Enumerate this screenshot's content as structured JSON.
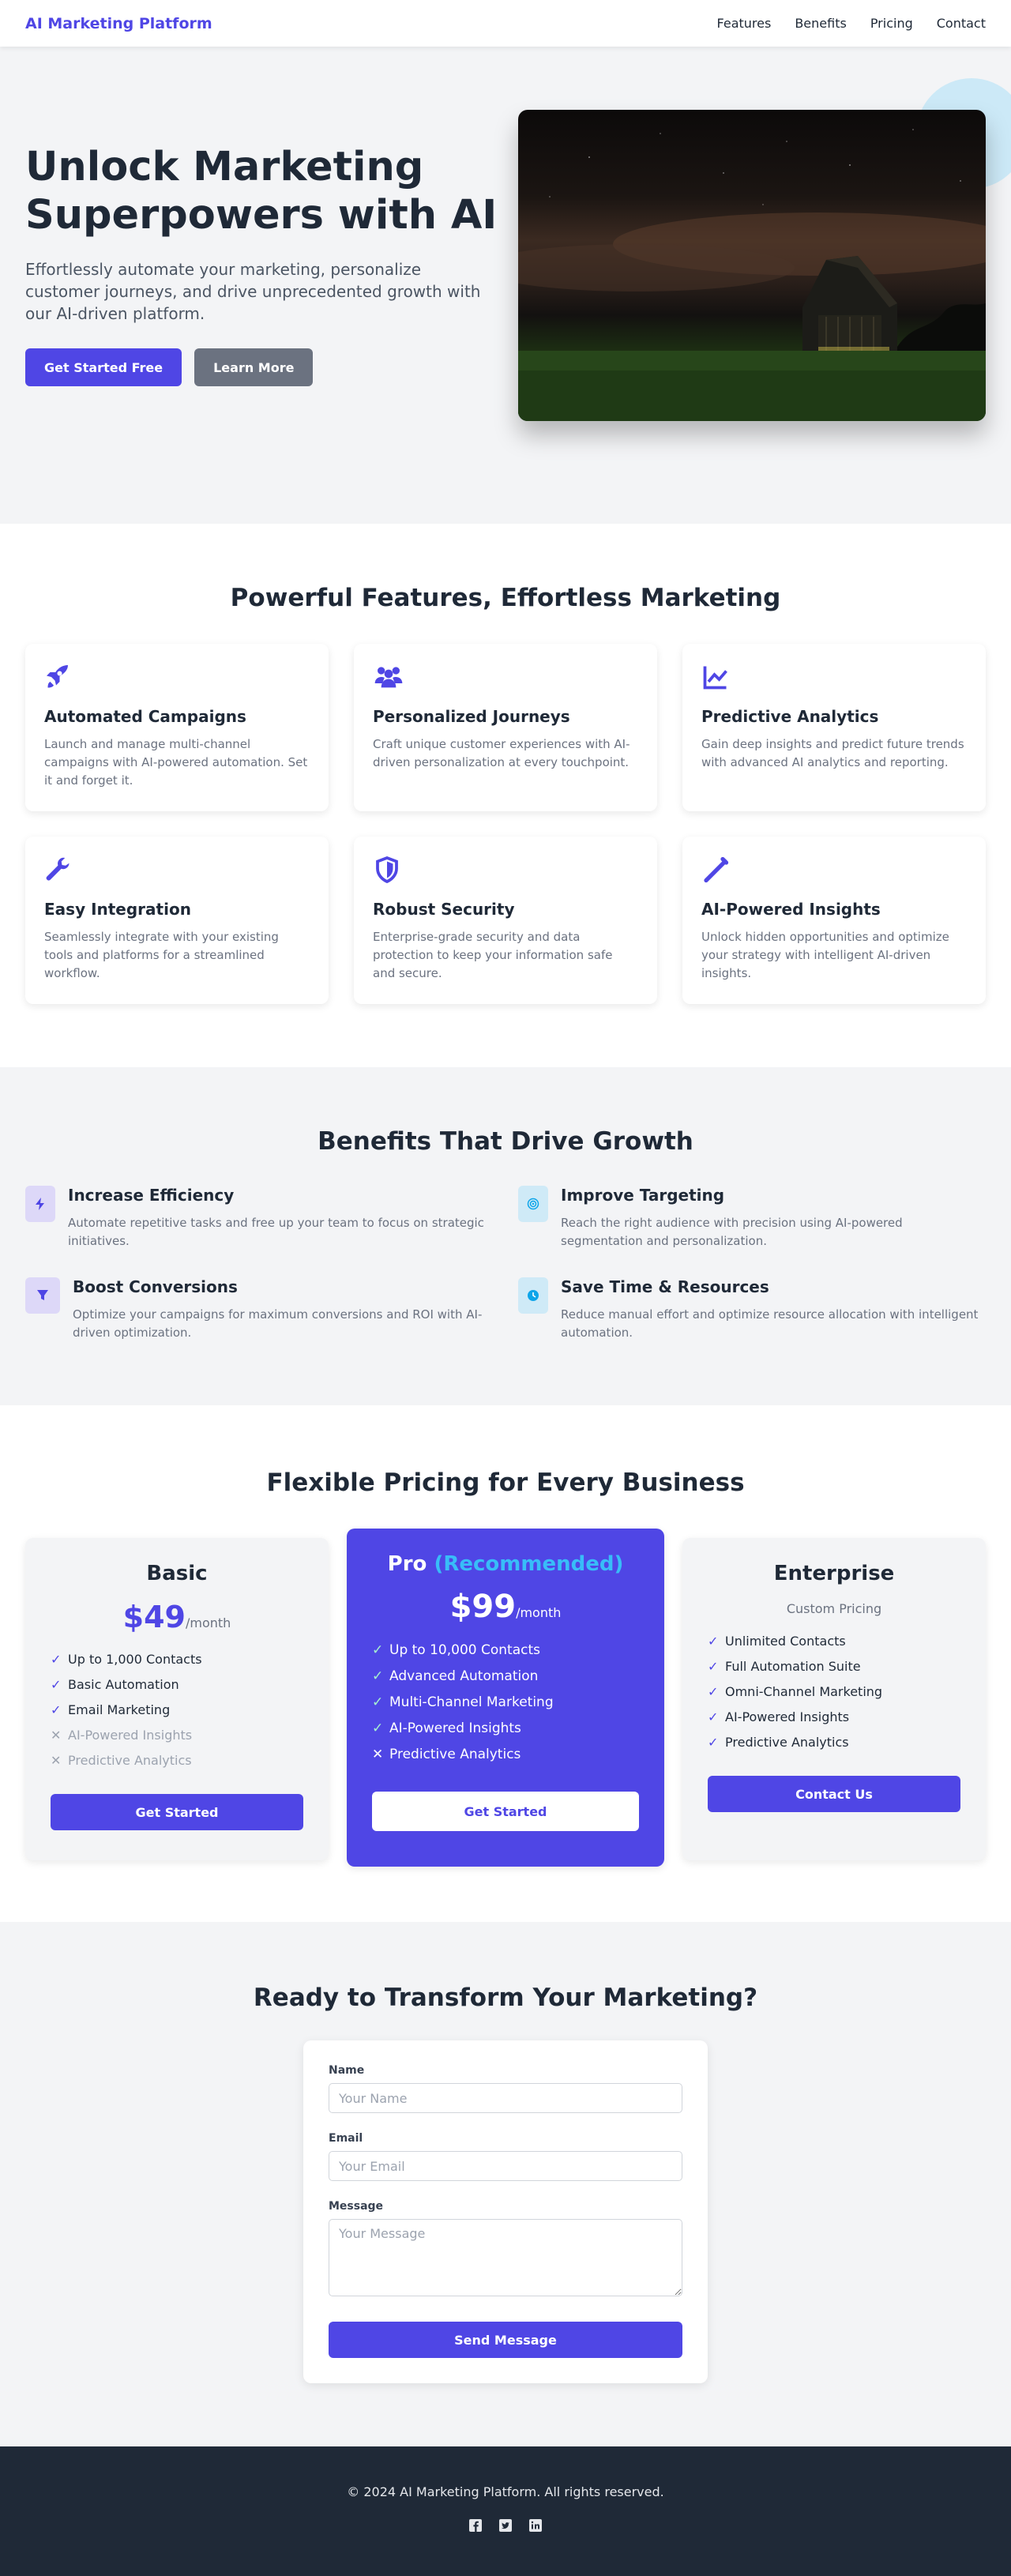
{
  "nav": {
    "brand": "AI Marketing Platform",
    "links": [
      "Features",
      "Benefits",
      "Pricing",
      "Contact"
    ]
  },
  "hero": {
    "title": "Unlock Marketing Superpowers with AI",
    "subtitle": "Effortlessly automate your marketing, personalize customer journeys, and drive unprecedented growth with our AI-driven platform.",
    "primary_button": "Get Started Free",
    "secondary_button": "Learn More"
  },
  "features": {
    "title": "Powerful Features, Effortless Marketing",
    "items": [
      {
        "icon": "rocket-icon",
        "title": "Automated Campaigns",
        "text": "Launch and manage multi-channel campaigns with AI-powered automation. Set it and forget it."
      },
      {
        "icon": "users-icon",
        "title": "Personalized Journeys",
        "text": "Craft unique customer experiences with AI-driven personalization at every touchpoint."
      },
      {
        "icon": "chart-line-icon",
        "title": "Predictive Analytics",
        "text": "Gain deep insights and predict future trends with advanced AI analytics and reporting."
      },
      {
        "icon": "wrench-icon",
        "title": "Easy Integration",
        "text": "Seamlessly integrate with your existing tools and platforms for a streamlined workflow."
      },
      {
        "icon": "shield-icon",
        "title": "Robust Security",
        "text": "Enterprise-grade security and data protection to keep your information safe and secure."
      },
      {
        "icon": "magic-wand-icon",
        "title": "AI-Powered Insights",
        "text": "Unlock hidden opportunities and optimize your strategy with intelligent AI-driven insights."
      }
    ]
  },
  "benefits": {
    "title": "Benefits That Drive Growth",
    "items": [
      {
        "icon": "bolt-icon",
        "title": "Increase Efficiency",
        "text": "Automate repetitive tasks and free up your team to focus on strategic initiatives."
      },
      {
        "icon": "target-icon",
        "title": "Improve Targeting",
        "text": "Reach the right audience with precision using AI-powered segmentation and personalization."
      },
      {
        "icon": "funnel-icon",
        "title": "Boost Conversions",
        "text": "Optimize your campaigns for maximum conversions and ROI with AI-driven optimization."
      },
      {
        "icon": "clock-icon",
        "title": "Save Time & Resources",
        "text": "Reduce manual effort and optimize resource allocation with intelligent automation."
      }
    ]
  },
  "pricing": {
    "title": "Flexible Pricing for Every Business",
    "basic": {
      "name": "Basic",
      "price": "$49",
      "period": "/month",
      "features": [
        {
          "text": "Up to 1,000 Contacts",
          "included": true
        },
        {
          "text": "Basic Automation",
          "included": true
        },
        {
          "text": "Email Marketing",
          "included": true
        },
        {
          "text": "AI-Powered Insights",
          "included": false
        },
        {
          "text": "Predictive Analytics",
          "included": false
        }
      ],
      "button": "Get Started"
    },
    "pro": {
      "name": "Pro",
      "badge": "(Recommended)",
      "price": "$99",
      "period": "/month",
      "features": [
        {
          "text": "Up to 10,000 Contacts",
          "included": true
        },
        {
          "text": "Advanced Automation",
          "included": true
        },
        {
          "text": "Multi-Channel Marketing",
          "included": true
        },
        {
          "text": "AI-Powered Insights",
          "included": true
        },
        {
          "text": "Predictive Analytics",
          "included": false
        }
      ],
      "button": "Get Started"
    },
    "enterprise": {
      "name": "Enterprise",
      "price_text": "Custom Pricing",
      "features": [
        {
          "text": "Unlimited Contacts",
          "included": true
        },
        {
          "text": "Full Automation Suite",
          "included": true
        },
        {
          "text": "Omni-Channel Marketing",
          "included": true
        },
        {
          "text": "AI-Powered Insights",
          "included": true
        },
        {
          "text": "Predictive Analytics",
          "included": true
        }
      ],
      "button": "Contact Us"
    }
  },
  "contact": {
    "title": "Ready to Transform Your Marketing?",
    "name_label": "Name",
    "name_placeholder": "Your Name",
    "email_label": "Email",
    "email_placeholder": "Your Email",
    "message_label": "Message",
    "message_placeholder": "Your Message",
    "submit": "Send Message"
  },
  "footer": {
    "copyright": "© 2024 AI Marketing Platform. All rights reserved.",
    "socials": [
      "facebook-icon",
      "twitter-icon",
      "linkedin-icon"
    ]
  },
  "colors": {
    "accent": "#4f46e5",
    "accent_light": "#38bdf8",
    "dark": "#1f2937",
    "muted": "#6b7280",
    "background_gray": "#f3f4f6"
  }
}
